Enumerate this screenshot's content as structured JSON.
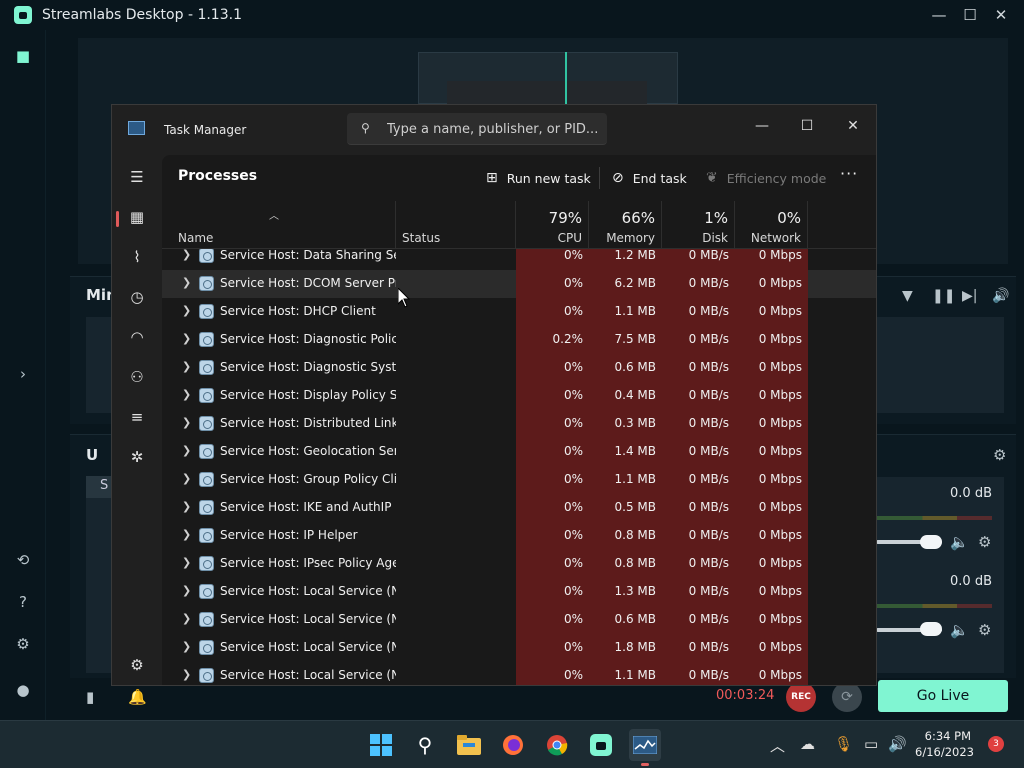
{
  "streamlabs": {
    "title": "Streamlabs Desktop - 1.13.1",
    "mixer_label": "Min",
    "second_panel_label": "U",
    "second_panel_tab": "S",
    "db_1": "0.0 dB",
    "db_2": "0.0 dB",
    "timer": "00:03:24",
    "rec_label": "REC",
    "go_live_label": "Go Live",
    "accent_color": "#80f5d2"
  },
  "task_manager": {
    "title": "Task Manager",
    "search_placeholder": "Type a name, publisher, or PID...",
    "page_title": "Processes",
    "toolbar": {
      "run_new_task": "Run new task",
      "end_task": "End task",
      "efficiency_mode": "Efficiency mode",
      "more": "···"
    },
    "columns": {
      "name": "Name",
      "status": "Status",
      "cpu_pct": "79%",
      "cpu": "CPU",
      "memory_pct": "66%",
      "memory": "Memory",
      "disk_pct": "1%",
      "disk": "Disk",
      "network_pct": "0%",
      "network": "Network"
    },
    "rows": [
      {
        "name": "Service Host: Data Sharing Ser...",
        "cpu": "0%",
        "memory": "1.2 MB",
        "disk": "0 MB/s",
        "network": "0 Mbps"
      },
      {
        "name": "Service Host: DCOM Server Pr...",
        "cpu": "0%",
        "memory": "6.2 MB",
        "disk": "0 MB/s",
        "network": "0 Mbps"
      },
      {
        "name": "Service Host: DHCP Client",
        "cpu": "0%",
        "memory": "1.1 MB",
        "disk": "0 MB/s",
        "network": "0 Mbps"
      },
      {
        "name": "Service Host: Diagnostic Polic...",
        "cpu": "0.2%",
        "memory": "7.5 MB",
        "disk": "0 MB/s",
        "network": "0 Mbps"
      },
      {
        "name": "Service Host: Diagnostic Syste...",
        "cpu": "0%",
        "memory": "0.6 MB",
        "disk": "0 MB/s",
        "network": "0 Mbps"
      },
      {
        "name": "Service Host: Display Policy Se...",
        "cpu": "0%",
        "memory": "0.4 MB",
        "disk": "0 MB/s",
        "network": "0 Mbps"
      },
      {
        "name": "Service Host: Distributed Link ...",
        "cpu": "0%",
        "memory": "0.3 MB",
        "disk": "0 MB/s",
        "network": "0 Mbps"
      },
      {
        "name": "Service Host: Geolocation Serv...",
        "cpu": "0%",
        "memory": "1.4 MB",
        "disk": "0 MB/s",
        "network": "0 Mbps"
      },
      {
        "name": "Service Host: Group Policy Cli...",
        "cpu": "0%",
        "memory": "1.1 MB",
        "disk": "0 MB/s",
        "network": "0 Mbps"
      },
      {
        "name": "Service Host: IKE and AuthIP I...",
        "cpu": "0%",
        "memory": "0.5 MB",
        "disk": "0 MB/s",
        "network": "0 Mbps"
      },
      {
        "name": "Service Host: IP Helper",
        "cpu": "0%",
        "memory": "0.8 MB",
        "disk": "0 MB/s",
        "network": "0 Mbps"
      },
      {
        "name": "Service Host: IPsec Policy Agent",
        "cpu": "0%",
        "memory": "0.8 MB",
        "disk": "0 MB/s",
        "network": "0 Mbps"
      },
      {
        "name": "Service Host: Local Service (N...",
        "cpu": "0%",
        "memory": "1.3 MB",
        "disk": "0 MB/s",
        "network": "0 Mbps"
      },
      {
        "name": "Service Host: Local Service (N...",
        "cpu": "0%",
        "memory": "0.6 MB",
        "disk": "0 MB/s",
        "network": "0 Mbps"
      },
      {
        "name": "Service Host: Local Service (N...",
        "cpu": "0%",
        "memory": "1.8 MB",
        "disk": "0 MB/s",
        "network": "0 Mbps"
      },
      {
        "name": "Service Host: Local Service (N...",
        "cpu": "0%",
        "memory": "1.1 MB",
        "disk": "0 MB/s",
        "network": "0 Mbps"
      }
    ],
    "heat_color": "#5d1b1b"
  },
  "taskbar": {
    "time": "6:34 PM",
    "date": "6/16/2023",
    "notification_count": "3"
  }
}
